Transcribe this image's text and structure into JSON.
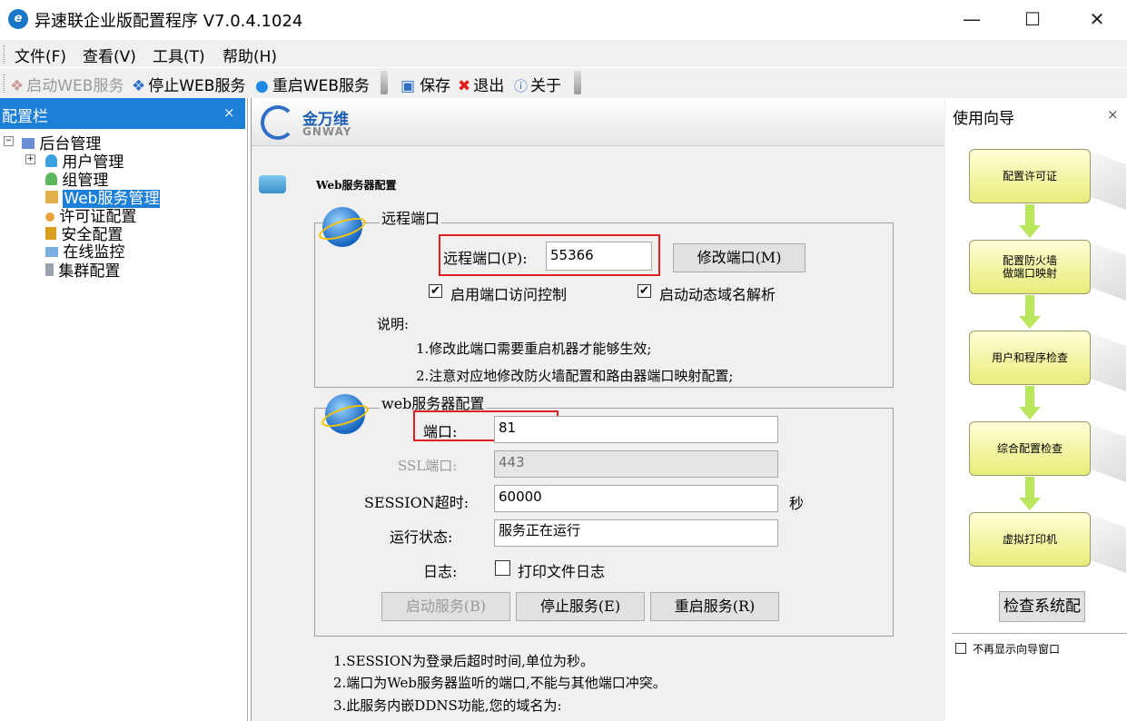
{
  "window": {
    "title": "异速联企业版配置程序 V7.0.4.1024",
    "icon_text": "e"
  },
  "menu": [
    {
      "label": "文件(F)"
    },
    {
      "label": "查看(V)"
    },
    {
      "label": "工具(T)"
    },
    {
      "label": "帮助(H)"
    }
  ],
  "toolbar": {
    "start_web": "启动WEB服务",
    "stop_web": "停止WEB服务",
    "restart_web": "重启WEB服务",
    "save": "保存",
    "exit": "退出",
    "about": "关于"
  },
  "left_panel": {
    "title": "配置栏",
    "tree": [
      {
        "label": "后台管理",
        "icon": "network-icon"
      },
      {
        "label": "用户管理",
        "icon": "user-icon"
      },
      {
        "label": "组管理",
        "icon": "group-icon"
      },
      {
        "label": "Web服务管理",
        "icon": "web-service-icon",
        "selected": true
      },
      {
        "label": "许可证配置",
        "icon": "key-icon"
      },
      {
        "label": "安全配置",
        "icon": "lock-icon"
      },
      {
        "label": "在线监控",
        "icon": "monitor-icon"
      },
      {
        "label": "集群配置",
        "icon": "server-icon"
      }
    ]
  },
  "banner": {
    "brand_cn": "金万维",
    "brand_en": "GNWAY"
  },
  "page": {
    "heading": "Web服务器配置"
  },
  "remote_port": {
    "group_title": "远程端口",
    "label": "远程端口(P):",
    "value": "55366",
    "modify_button": "修改端口(M)",
    "enable_access_control": "启用端口访问控制",
    "enable_ddns": "启动动态域名解析",
    "note_title": "说明:",
    "note_1": "1.修改此端口需要重启机器才能够生效;",
    "note_2": "2.注意对应地修改防火墙配置和路由器端口映射配置;"
  },
  "web_config": {
    "group_title": "web服务器配置",
    "port_label": "端口:",
    "port_value": "81",
    "ssl_label": "SSL端口:",
    "ssl_value": "443",
    "session_label": "SESSION超时:",
    "session_value": "60000",
    "session_unit": "秒",
    "status_label": "运行状态:",
    "status_value": "服务正在运行",
    "log_label": "日志:",
    "log_checkbox": "打印文件日志",
    "start_button": "启动服务(B)",
    "stop_button": "停止服务(E)",
    "restart_button": "重启服务(R)"
  },
  "footer_notes": {
    "n1": "1.SESSION为登录后超时时间,单位为秒。",
    "n2": "2.端口为Web服务器监听的端口,不能与其他端口冲突。",
    "n3": "3.此服务内嵌DDNS功能,您的域名为:"
  },
  "wizard": {
    "title": "使用向导",
    "steps": [
      "配置许可证",
      "配置防火墙\n做端口映射",
      "用户和程序检查",
      "综合配置检查",
      "虚拟打印机"
    ],
    "check_button": "检查系统配",
    "no_show": "不再显示向导窗口"
  },
  "colors": {
    "accent": "#1e7fd8",
    "highlight_red": "#e02020",
    "wizard_box": "#f0f39b",
    "arrow": "#b9e65a"
  }
}
